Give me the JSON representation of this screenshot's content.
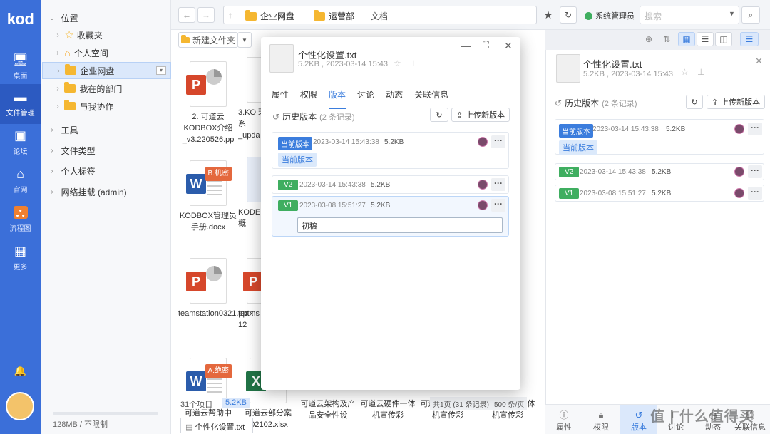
{
  "rail": {
    "logo": "kod",
    "items": [
      {
        "label": "桌面",
        "icon": "desktop-icon"
      },
      {
        "label": "文件管理",
        "icon": "folder-icon"
      },
      {
        "label": "论坛",
        "icon": "chat-icon"
      },
      {
        "label": "官网",
        "icon": "home-icon"
      },
      {
        "label": "流程图",
        "icon": "flowchart-icon"
      },
      {
        "label": "更多",
        "icon": "grid-icon"
      }
    ]
  },
  "tree": {
    "location_label": "位置",
    "items": [
      "收藏夹",
      "个人空间",
      "企业网盘",
      "我在的部门",
      "与我协作"
    ],
    "sections": [
      "工具",
      "文件类型",
      "个人标签",
      "网络挂载 (admin)"
    ],
    "storage": "128MB / 不限制"
  },
  "topbar": {
    "crumbs": [
      "企业网盘",
      "运营部",
      "文档"
    ],
    "user": "系统管理员",
    "search_placeholder": "搜索"
  },
  "toolbar": {
    "new_folder": "新建文件夹"
  },
  "files": [
    {
      "name": "2. 可道云KODBOX介绍_v3.220526.pp",
      "type": "P"
    },
    {
      "name": "3.KO 理系 _upda",
      "type": "doc"
    },
    {
      "name": "KODBOX管理员手册.docx",
      "type": "W",
      "badge": "B.机密"
    },
    {
      "name": "KODE 概",
      "type": "doc"
    },
    {
      "name": "teamstation0321.pptx",
      "type": "P"
    },
    {
      "name": "teams 12",
      "type": "P"
    },
    {
      "name": "可道云帮助中",
      "type": "W",
      "badge": "A.绝密"
    },
    {
      "name": "可道云部分案 .02102.xlsx",
      "type": "X"
    },
    {
      "name": "可道云架构及产品安全性设",
      "type": "none"
    },
    {
      "name": "可道云硬件一体机宣传彩",
      "type": "none"
    },
    {
      "name": "可道云硬件一体机宣传彩",
      "type": "none"
    },
    {
      "name": "可道云硬件一体机宣传彩",
      "type": "none"
    }
  ],
  "status": {
    "count": "31个项目",
    "size": "5.2KB",
    "page": "共1页 (31 条记录)",
    "per_page": "500 条/页",
    "selected_file": "个性化设置.txt"
  },
  "dialog": {
    "filename": "个性化设置.txt",
    "meta": "5.2KB , 2023-03-14 15:43",
    "tabs": [
      "属性",
      "权限",
      "版本",
      "讨论",
      "动态",
      "关联信息"
    ],
    "history_title": "历史版本",
    "history_count": "(2 条记录)",
    "upload_label": "上传新版本",
    "versions": [
      {
        "tag": "当前版本",
        "time": "2023-03-14 15:43:38",
        "size": "5.2KB",
        "note": "当前版本"
      },
      {
        "tag": "V2",
        "time": "2023-03-14 15:43:38",
        "size": "5.2KB"
      },
      {
        "tag": "V1",
        "time": "2023-03-08 15:51:27",
        "size": "5.2KB",
        "note": "初稿"
      }
    ]
  },
  "rpanel": {
    "filename": "个性化设置.txt",
    "meta": "5.2KB , 2023-03-14 15:43",
    "history_title": "历史版本",
    "history_count": "(2 条记录)",
    "upload_label": "上传新版本",
    "versions": [
      {
        "tag": "当前版本",
        "time": "2023-03-14 15:43:38",
        "size": "5.2KB",
        "note": "当前版本"
      },
      {
        "tag": "V2",
        "time": "2023-03-14 15:43:38",
        "size": "5.2KB"
      },
      {
        "tag": "V1",
        "time": "2023-03-08 15:51:27",
        "size": "5.2KB"
      }
    ],
    "bottom_tabs": [
      "属性",
      "权限",
      "版本",
      "讨论",
      "动态",
      "关联信息"
    ]
  },
  "watermark": "值 | 什么值得买"
}
